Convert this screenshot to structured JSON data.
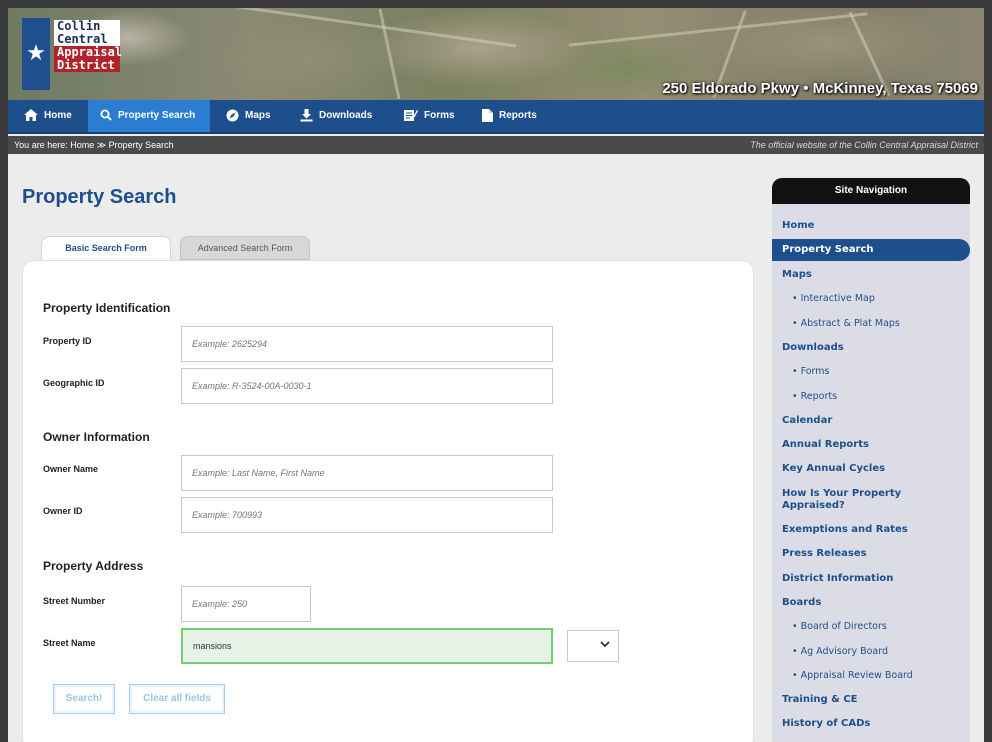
{
  "banner": {
    "logo": [
      "Collin",
      "Central",
      "Appraisal",
      "District"
    ],
    "address": "250 Eldorado Pkwy • McKinney, Texas 75069"
  },
  "nav": [
    {
      "label": "Home",
      "icon": "home-icon"
    },
    {
      "label": "Property Search",
      "icon": "search-icon"
    },
    {
      "label": "Maps",
      "icon": "compass-icon"
    },
    {
      "label": "Downloads",
      "icon": "download-icon"
    },
    {
      "label": "Forms",
      "icon": "form-icon"
    },
    {
      "label": "Reports",
      "icon": "document-icon"
    }
  ],
  "breadcrumb": {
    "text": "You are here: Home ≫ Property Search",
    "tagline": "The official website of the Collin Central Appraisal District"
  },
  "page_title": "Property Search",
  "tabs": {
    "basic": "Basic Search Form",
    "advanced": "Advanced Search Form"
  },
  "form": {
    "sections": {
      "identification": "Property Identification",
      "owner": "Owner Information",
      "address": "Property Address"
    },
    "fields": {
      "property_id": {
        "label": "Property ID",
        "placeholder": "Example: 2625294",
        "value": ""
      },
      "geographic_id": {
        "label": "Geographic ID",
        "placeholder": "Example: R-3524-00A-0030-1",
        "value": ""
      },
      "owner_name": {
        "label": "Owner Name",
        "placeholder": "Example: Last Name, First Name",
        "value": ""
      },
      "owner_id": {
        "label": "Owner ID",
        "placeholder": "Example: 700993",
        "value": ""
      },
      "street_number": {
        "label": "Street Number",
        "placeholder": "Example: 250",
        "value": ""
      },
      "street_name": {
        "label": "Street Name",
        "placeholder": "",
        "value": "mansions"
      }
    },
    "buttons": {
      "search": "Search!",
      "clear": "Clear all fields"
    }
  },
  "site_nav": {
    "title": "Site Navigation",
    "items": [
      {
        "label": "Home",
        "sub": false
      },
      {
        "label": "Property Search",
        "sub": false,
        "active": true
      },
      {
        "label": "Maps",
        "sub": false
      },
      {
        "label": "• Interactive Map",
        "sub": true
      },
      {
        "label": "• Abstract & Plat Maps",
        "sub": true
      },
      {
        "label": "Downloads",
        "sub": false
      },
      {
        "label": "• Forms",
        "sub": true
      },
      {
        "label": "• Reports",
        "sub": true
      },
      {
        "label": "Calendar",
        "sub": false
      },
      {
        "label": "Annual Reports",
        "sub": false
      },
      {
        "label": "Key Annual Cycles",
        "sub": false
      },
      {
        "label": "How Is Your Property",
        "sub": false
      },
      {
        "label": "Appraised?",
        "sub": false
      },
      {
        "label": "Exemptions and Rates",
        "sub": false
      },
      {
        "label": "Press Releases",
        "sub": false
      },
      {
        "label": "District Information",
        "sub": false
      },
      {
        "label": "Boards",
        "sub": false
      },
      {
        "label": "• Board of Directors",
        "sub": true
      },
      {
        "label": "• Ag Advisory Board",
        "sub": true
      },
      {
        "label": "• Appraisal Review Board",
        "sub": true
      },
      {
        "label": "Training & CE",
        "sub": false
      },
      {
        "label": "History of CADs",
        "sub": false
      }
    ]
  },
  "colors": {
    "brand_blue": "#1d4f8c",
    "nav_active": "#2a7dd1",
    "logo_red": "#b0232a",
    "input_valid_border": "#6fcf6f"
  }
}
